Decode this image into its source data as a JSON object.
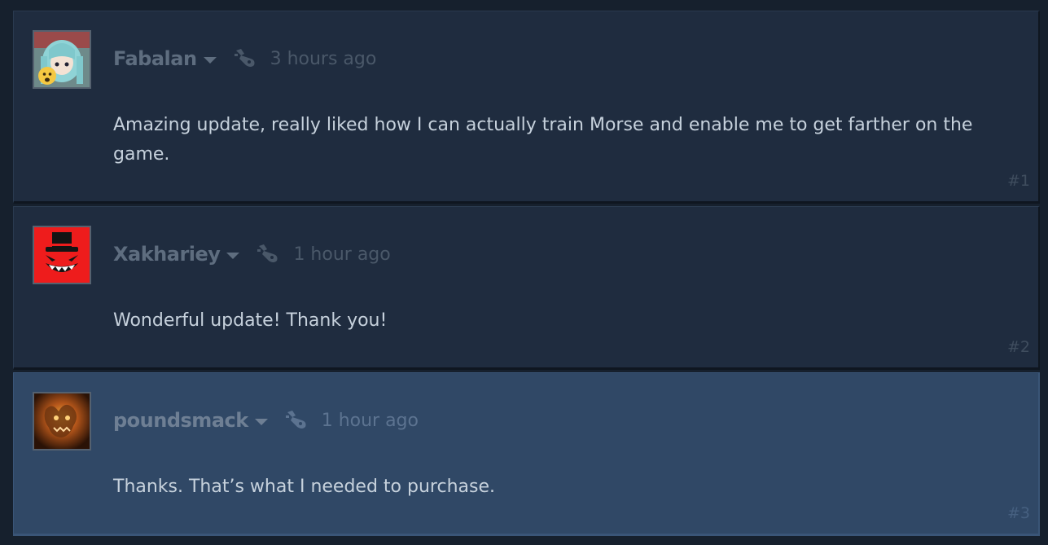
{
  "colors": {
    "page_bg": "#16202d",
    "comment_bg": "#1f2c3f",
    "comment_highlight_bg": "#304866",
    "author_text": "#5e6d7f",
    "body_text": "#c6d1dc"
  },
  "comments": [
    {
      "author": "Fabalan",
      "time": "3 hours ago",
      "text": "Amazing update, really liked how I can actually train Morse and enable me to get farther on the game.",
      "number": "#1",
      "avatar_icon": "anime-figure-avatar",
      "highlighted": false
    },
    {
      "author": "Xakhariey",
      "time": "1 hour ago",
      "text": "Wonderful update! Thank you!",
      "number": "#2",
      "avatar_icon": "red-top-hat-grin-avatar",
      "highlighted": false
    },
    {
      "author": "poundsmack",
      "time": "1 hour ago",
      "text": "Thanks. That’s what I needed to purchase.",
      "number": "#3",
      "avatar_icon": "fiery-creature-avatar",
      "highlighted": true
    }
  ]
}
